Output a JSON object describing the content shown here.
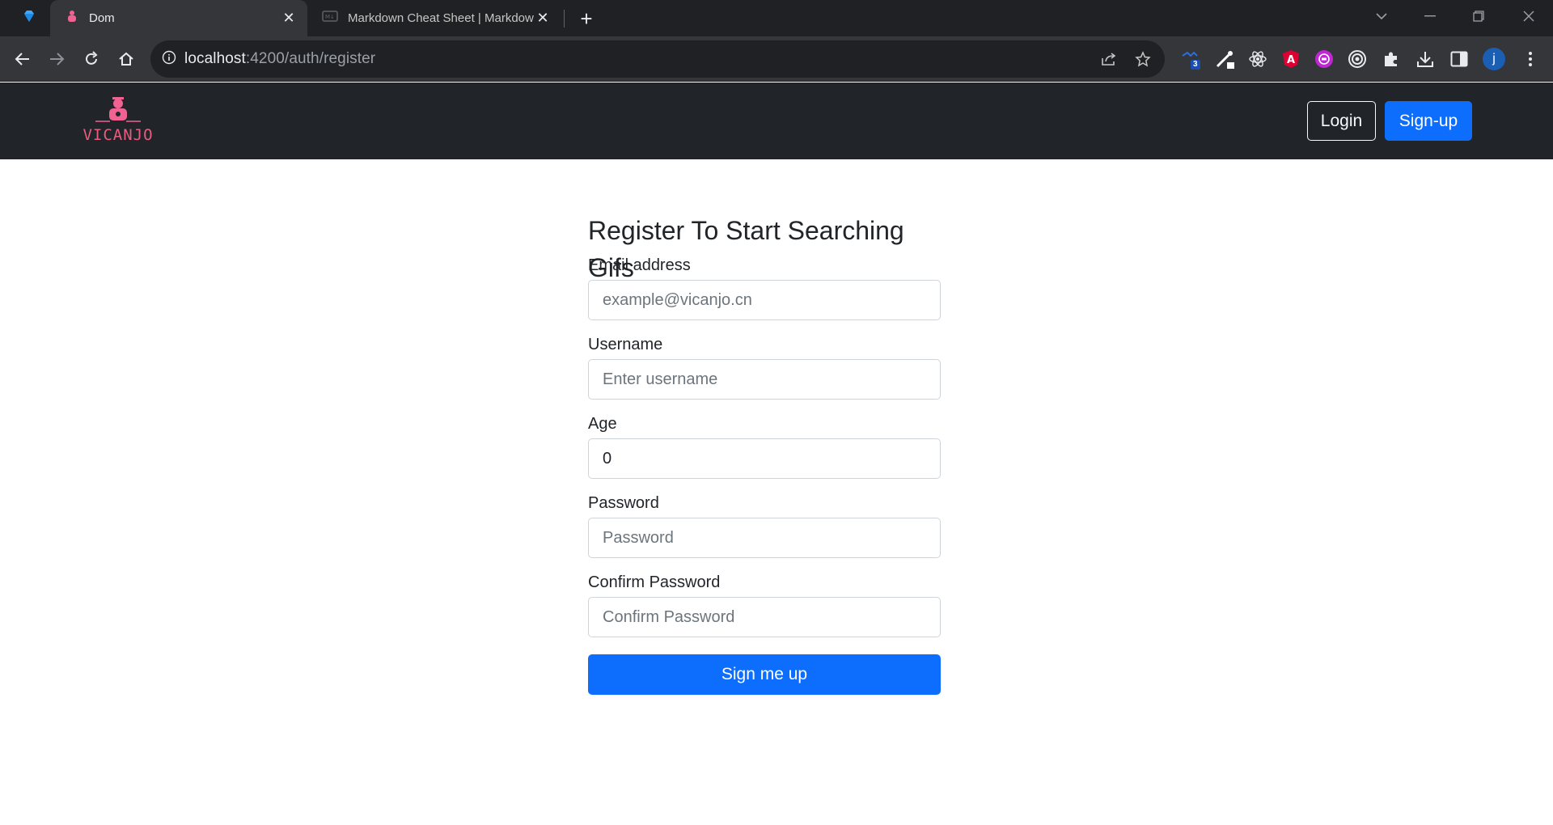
{
  "browser": {
    "tabs": [
      {
        "title": "Dom",
        "active": true
      },
      {
        "title": "Markdown Cheat Sheet | Markdown",
        "active": false
      }
    ],
    "url_host": "localhost",
    "url_rest": ":4200/auth/register",
    "profile_initial": "j",
    "extension_badge": "3",
    "accent": "#0d6efd"
  },
  "navbar": {
    "brand": "VICANJO",
    "login_label": "Login",
    "signup_label": "Sign-up"
  },
  "form": {
    "title": "Register To Start Searching Gifs",
    "email_label": "Email address",
    "email_placeholder": "example@vicanjo.cn",
    "username_label": "Username",
    "username_placeholder": "Enter username",
    "age_label": "Age",
    "age_value": "0",
    "password_label": "Password",
    "password_placeholder": "Password",
    "confirm_label": "Confirm Password",
    "confirm_placeholder": "Confirm Password",
    "submit_label": "Sign me up"
  }
}
